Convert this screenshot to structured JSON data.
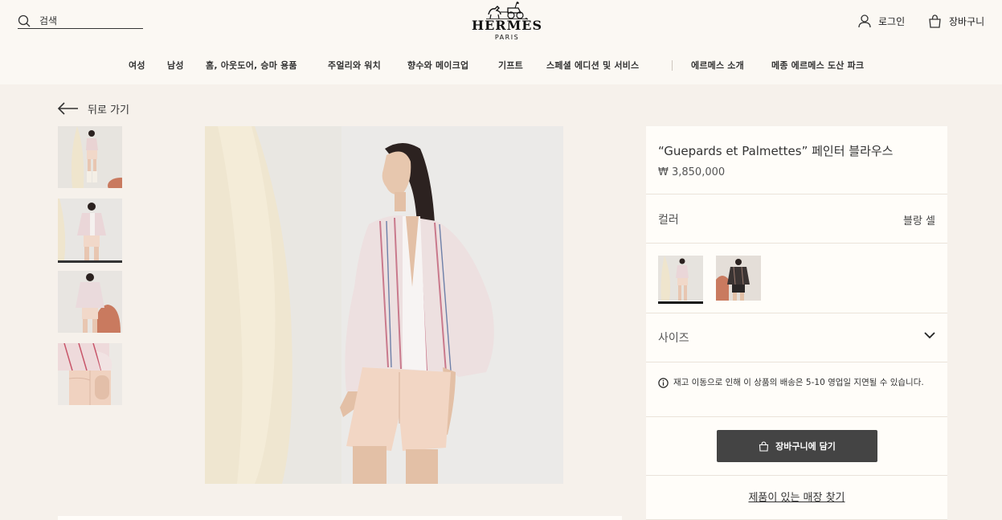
{
  "header": {
    "search": {
      "placeholder": "검색",
      "icon": "search-icon"
    },
    "logo": {
      "brand": "HERMÈS",
      "city": "PARIS"
    },
    "login_label": "로그인",
    "cart_label": "장바구니"
  },
  "nav": {
    "items": [
      "여성",
      "남성",
      "홈, 아웃도어, 승마 용품",
      "주얼리와 워치",
      "향수와 메이크업",
      "기프트",
      "스페셜 에디션 및 서비스",
      "에르메스 소개",
      "메종 에르메스 도산 파크"
    ]
  },
  "back_label": "뒤로 가기",
  "gallery": {
    "thumbnail_count": 4,
    "active_index": 1
  },
  "product": {
    "title": "“Guepards et Palmettes” 페인터 블라우스",
    "price": "₩ 3,850,000",
    "color_label": "컬러",
    "color_value": "블랑 셀",
    "size_label": "사이즈",
    "notice": "재고 이동으로 인해 이 상품의 배송은 5-10 영업일 지연될 수 있습니다.",
    "add_to_cart": "장바구니에 담기",
    "find_store": "제품이 있는 매장 찾기"
  },
  "colors": {
    "accent": "#444444",
    "background": "#f6f1eb",
    "panel": "#fffdf9"
  }
}
